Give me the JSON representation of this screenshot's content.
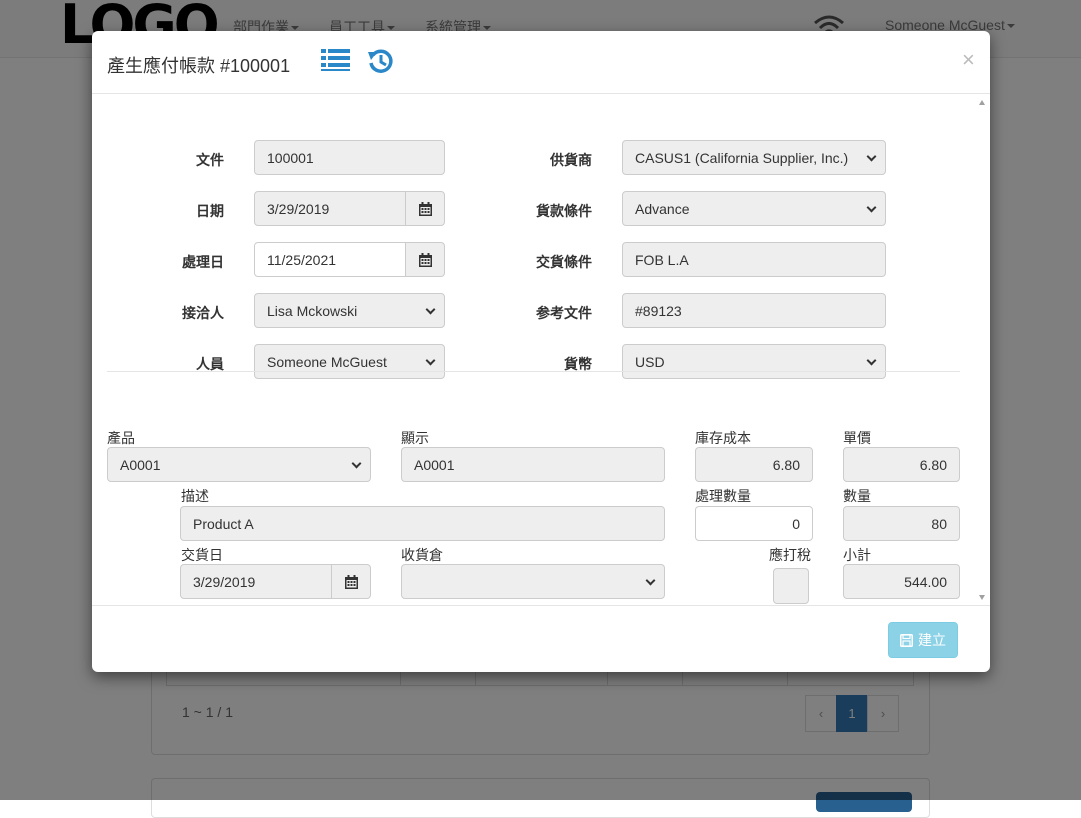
{
  "navbar": {
    "logo": "LOGO",
    "menu": [
      "部門作業",
      "員工工具",
      "系統管理"
    ],
    "user": "Someone McGuest"
  },
  "background": {
    "pager_text": "1 ~ 1 / 1",
    "pager": {
      "prev": "‹",
      "page": "1",
      "next": "›"
    }
  },
  "modal": {
    "title": "產生應付帳款 #100001",
    "close": "×",
    "form": {
      "doc_label": "文件",
      "doc_value": "100001",
      "date_label": "日期",
      "date_value": "3/29/2019",
      "process_date_label": "處理日",
      "process_date_value": "11/25/2021",
      "contact_label": "接洽人",
      "contact_value": "Lisa Mckowski",
      "staff_label": "人員",
      "staff_value": "Someone McGuest",
      "supplier_label": "供貨商",
      "supplier_value": "CASUS1 (California Supplier, Inc.)",
      "payment_terms_label": "貨款條件",
      "payment_terms_value": "Advance",
      "delivery_terms_label": "交貨條件",
      "delivery_terms_value": "FOB L.A",
      "reference_label": "参考文件",
      "reference_value": "#89123",
      "currency_label": "貨幣",
      "currency_value": "USD"
    },
    "line": {
      "product_label": "產品",
      "product_value": "A0001",
      "display_label": "顯示",
      "display_value": "A0001",
      "inventory_cost_label": "庫存成本",
      "inventory_cost_value": "6.80",
      "unit_price_label": "單價",
      "unit_price_value": "6.80",
      "description_label": "描述",
      "description_value": "Product A",
      "process_qty_label": "處理數量",
      "process_qty_value": "0",
      "quantity_label": "數量",
      "quantity_value": "80",
      "delivery_date_label": "交貨日",
      "delivery_date_value": "3/29/2019",
      "warehouse_label": "收貨倉",
      "warehouse_value": "",
      "taxable_label": "應打稅",
      "subtotal_label": "小計",
      "subtotal_value": "544.00"
    },
    "footer": {
      "create_label": "建立"
    }
  },
  "colors": {
    "accent": "#2a87c8",
    "create_button": "#5bc0de",
    "pager_active": "#337ab7"
  }
}
